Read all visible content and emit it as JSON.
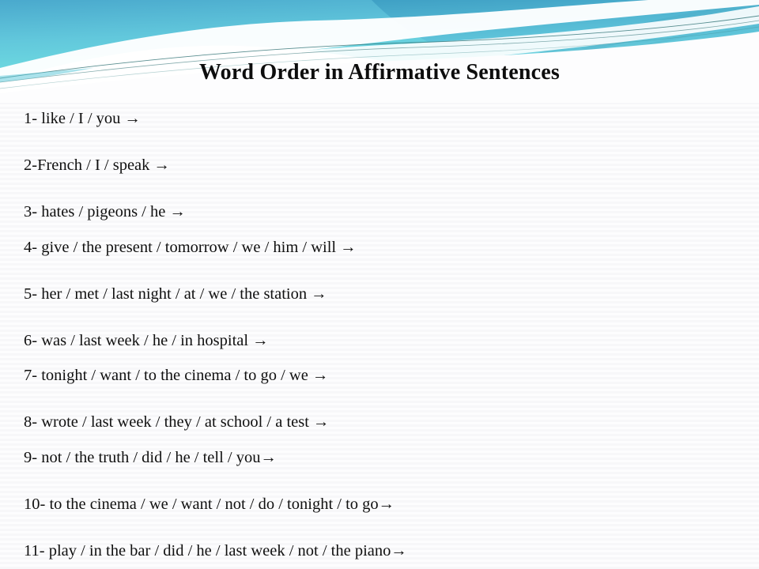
{
  "slide": {
    "title": "Word Order in Affirmative Sentences",
    "background_color": "#fbfbfc",
    "title_color": "#0d0d0d"
  },
  "banner": {
    "name": "decorative-wave-banner",
    "colors": {
      "teal_dark": "#3e9fc4",
      "teal_mid": "#62c4da",
      "teal_light": "#76dede",
      "cyan_bright": "#6fe8e6",
      "ribbon_white": "#ffffff",
      "hairline": "#2d6f72"
    }
  },
  "exercises": [
    {
      "number": "1-",
      "text": "1- like / I / you →",
      "spacing": "gap-none"
    },
    {
      "number": "2-",
      "text": "2-French / I / speak →",
      "spacing": "gap-lg"
    },
    {
      "number": "3-",
      "text": "3- hates / pigeons / he →",
      "spacing": "gap-lg"
    },
    {
      "number": "4-",
      "text": "4- give / the present / tomorrow / we / him / will →",
      "spacing": "gap-sm"
    },
    {
      "number": "5-",
      "text": "5- her / met / last night / at / we / the station →",
      "spacing": "gap-lg"
    },
    {
      "number": "6-",
      "text": "6- was / last week / he / in hospital →",
      "spacing": "gap-lg"
    },
    {
      "number": "7-",
      "text": "7- tonight / want / to the cinema / to go / we →",
      "spacing": "gap-sm"
    },
    {
      "number": "8-",
      "text": "8- wrote / last week / they / at school / a test →",
      "spacing": "gap-lg"
    },
    {
      "number": "9-",
      "text": "9- not / the truth / did / he / tell / you→",
      "spacing": "gap-sm"
    },
    {
      "number": "10-",
      "text": "10- to the cinema / we / want / not / do / tonight / to go→",
      "spacing": "gap-lg"
    },
    {
      "number": "11-",
      "text": "11- play / in the bar / did / he / last week / not / the piano→",
      "spacing": "gap-lg"
    }
  ]
}
